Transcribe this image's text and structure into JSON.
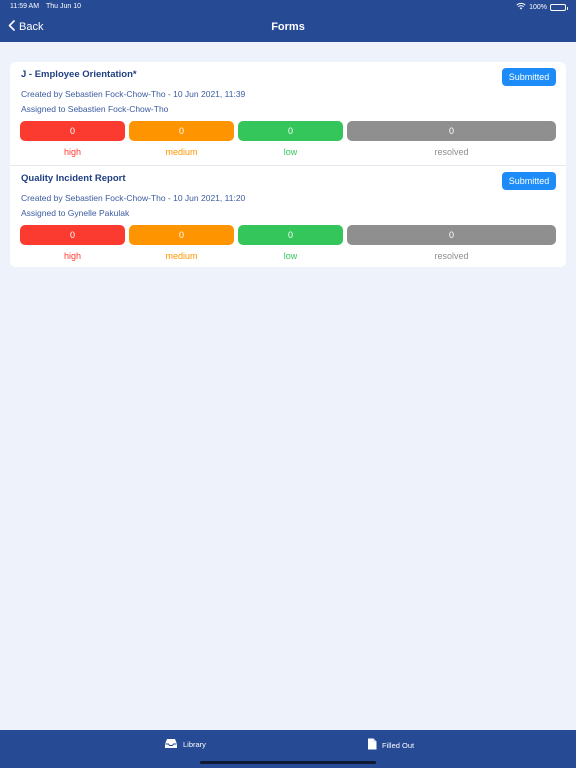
{
  "status": {
    "time": "11:59 AM",
    "date": "Thu Jun 10",
    "battery": "100%",
    "icons": [
      "wifi-icon",
      "battery-icon"
    ]
  },
  "nav": {
    "back_label": "Back",
    "title": "Forms"
  },
  "forms": [
    {
      "title": "J - Employee Orientation*",
      "created": "Created by Sebastien Fock-Chow-Tho - 10 Jun 2021, 11:39",
      "assigned": "Assigned to Sebastien Fock-Chow-Tho",
      "status": "Submitted",
      "counts": {
        "high": "0",
        "medium": "0",
        "low": "0",
        "resolved": "0"
      }
    },
    {
      "title": "Quality Incident Report",
      "created": "Created by Sebastien Fock-Chow-Tho - 10 Jun 2021, 11:20",
      "assigned": "Assigned to Gynelle Pakulak",
      "status": "Submitted",
      "counts": {
        "high": "0",
        "medium": "0",
        "low": "0",
        "resolved": "0"
      }
    }
  ],
  "labels": {
    "high": "high",
    "medium": "medium",
    "low": "low",
    "resolved": "resolved"
  },
  "colors": {
    "nav_bg": "#264a93",
    "badge": "#1d8cf8",
    "high": "#fb3b30",
    "medium": "#fe9500",
    "low": "#34c65a",
    "resolved": "#8f8f8f"
  },
  "tabs": {
    "library": "Library",
    "filled_out": "Filled Out",
    "icons": [
      "inbox-icon",
      "document-icon"
    ]
  }
}
